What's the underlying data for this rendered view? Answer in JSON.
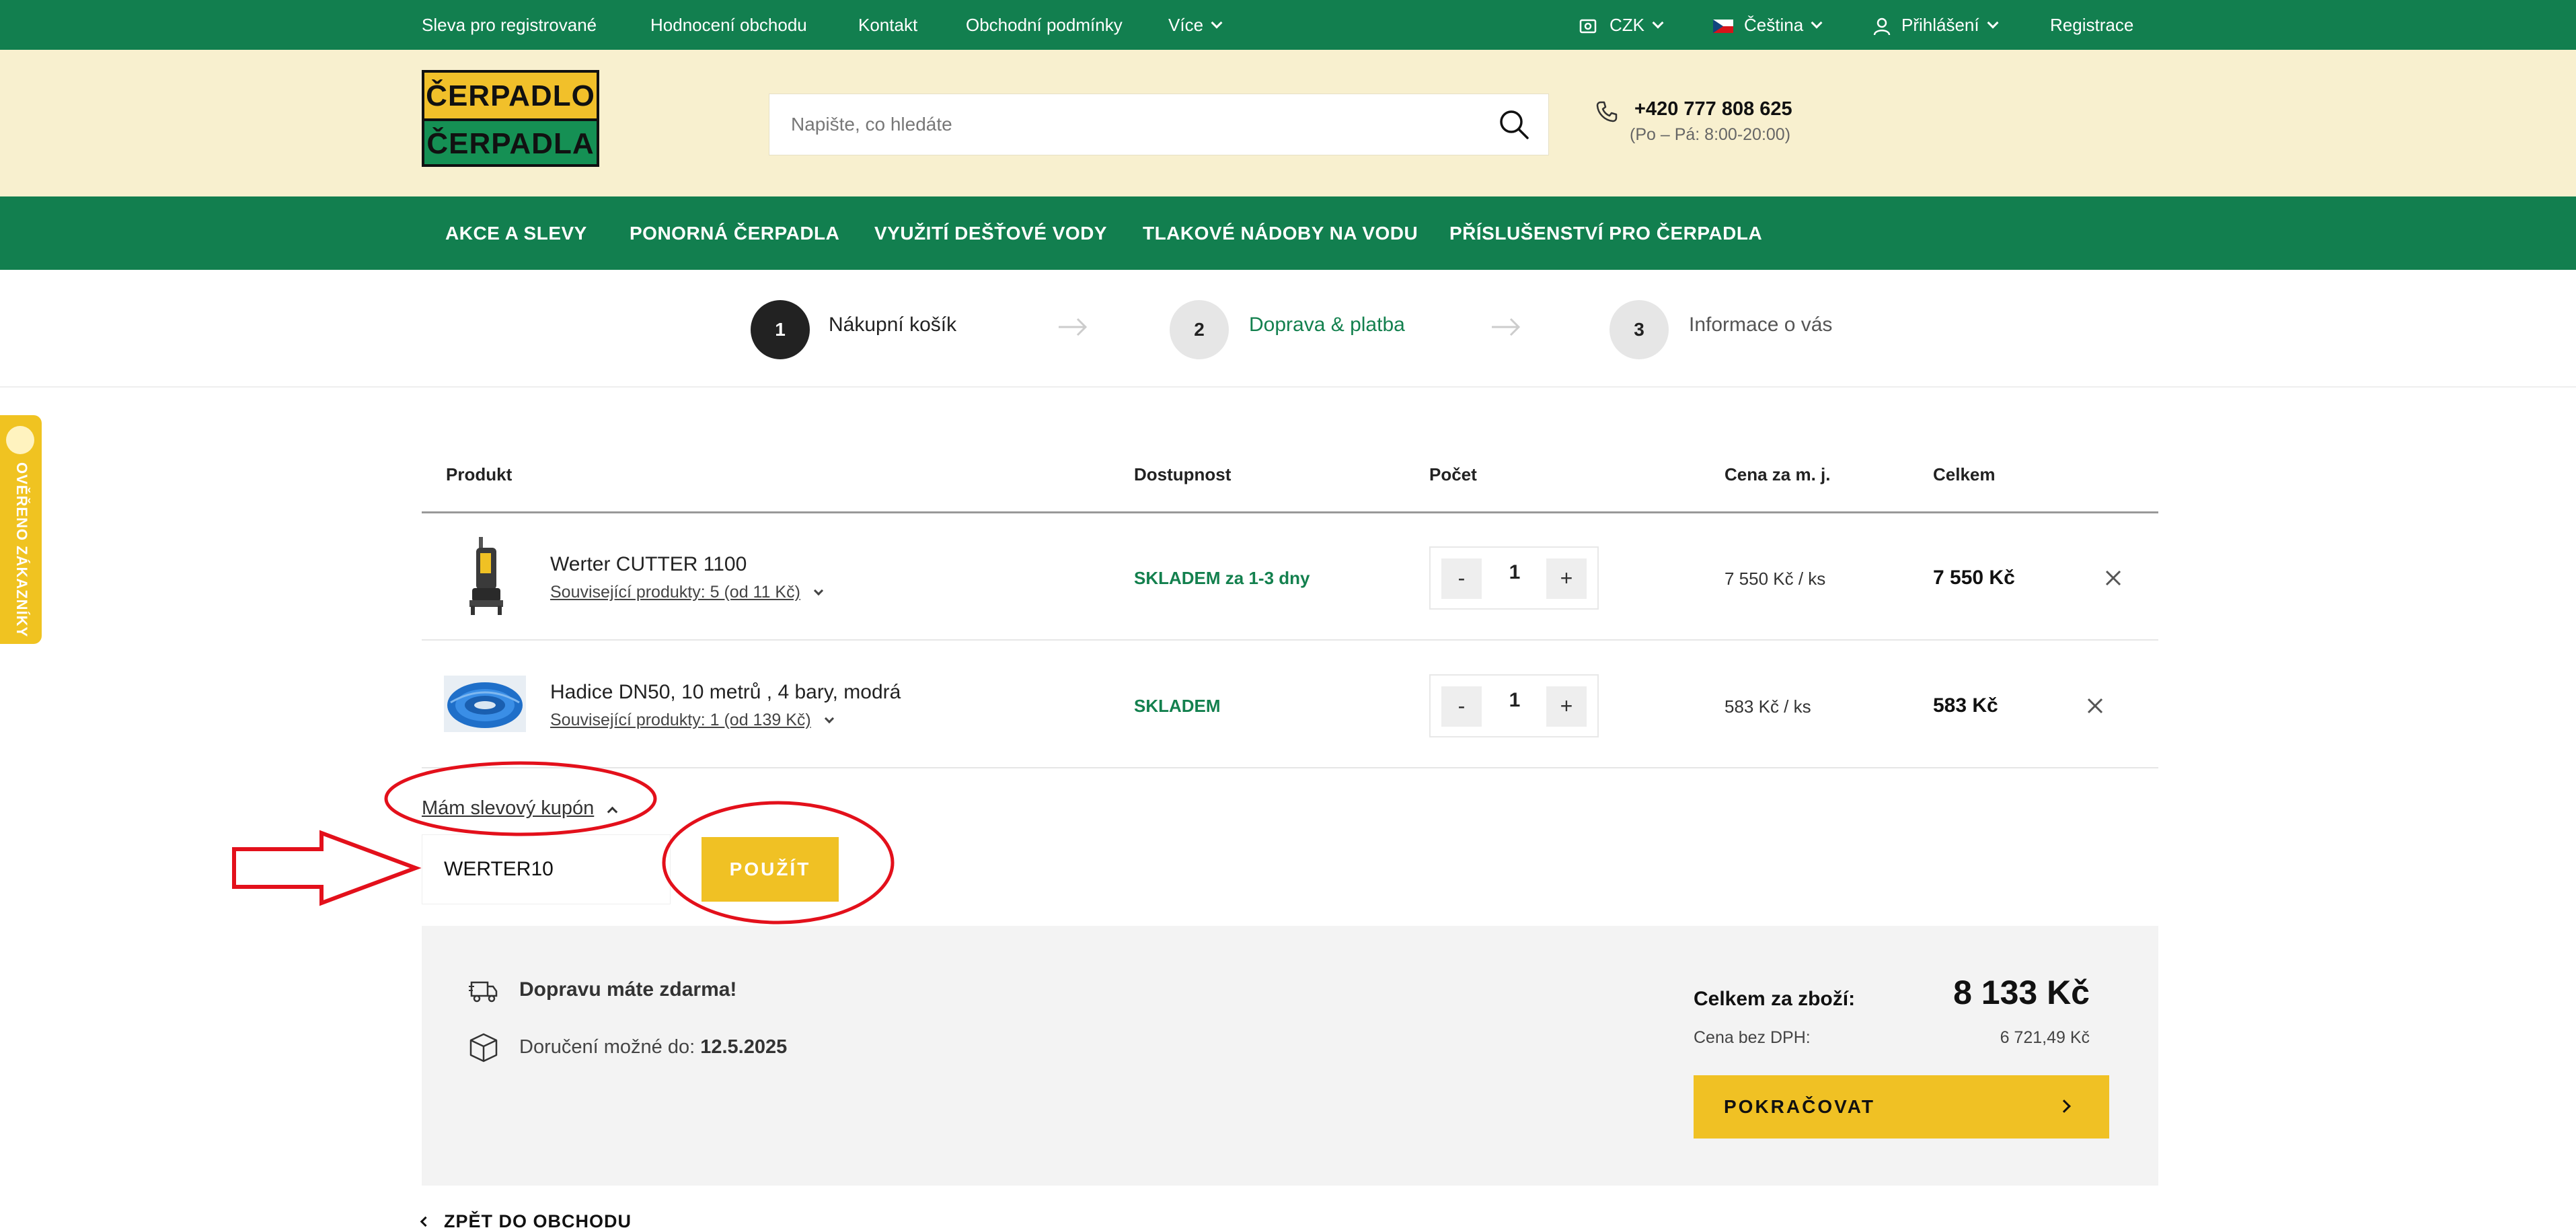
{
  "topbar": {
    "links": [
      "Sleva pro registrované",
      "Hodnocení obchodu",
      "Kontakt",
      "Obchodní podmínky",
      "Více"
    ],
    "currency": "CZK",
    "language": "Čeština",
    "login": "Přihlášení",
    "register": "Registrace"
  },
  "header": {
    "logo_top": "ČERPADLO",
    "logo_bottom": "ČERPADLA",
    "search_placeholder": "Napište, co hledáte",
    "phone": "+420 777 808 625",
    "hours": "(Po – Pá: 8:00-20:00)"
  },
  "nav": {
    "items": [
      "AKCE A SLEVY",
      "PONORNÁ ČERPADLA",
      "VYUŽITÍ DEŠŤOVÉ VODY",
      "TLAKOVÉ NÁDOBY NA VODU",
      "PŘÍSLUŠENSTVÍ PRO ČERPADLA"
    ]
  },
  "steps": [
    {
      "number": "1",
      "label": "Nákupní košík"
    },
    {
      "number": "2",
      "label": "Doprava & platba"
    },
    {
      "number": "3",
      "label": "Informace o vás"
    }
  ],
  "side_badge": "OVĚŘENO ZÁKAZNÍKY",
  "table": {
    "headers": {
      "product": "Produkt",
      "availability": "Dostupnost",
      "count": "Počet",
      "unit_price": "Cena za m. j.",
      "total": "Celkem"
    },
    "rows": [
      {
        "name": "Werter CUTTER 1100",
        "related": "Související produkty: 5 (od 11 Kč)",
        "stock": "SKLADEM za 1-3 dny",
        "qty": "1",
        "unit_price": "7 550 Kč / ks",
        "total": "7 550 Kč"
      },
      {
        "name": "Hadice DN50, 10 metrů , 4 bary, modrá",
        "related": "Související produkty: 1 (od 139 Kč)",
        "stock": "SKLADEM",
        "qty": "1",
        "unit_price": "583 Kč / ks",
        "total": "583 Kč"
      }
    ],
    "minus": "-",
    "plus": "+"
  },
  "coupon": {
    "toggle": "Mám slevový kupón",
    "value": "WERTER10",
    "apply": "POUŽÍT"
  },
  "summary": {
    "free_shipping": "Dopravu máte zdarma!",
    "delivery_label": "Doručení možné do:",
    "delivery_date": "12.5.2025",
    "total_label": "Celkem za zboží:",
    "total_value": "8 133 Kč",
    "net_label": "Cena bez DPH:",
    "net_value": "6 721,49 Kč",
    "continue": "POKRAČOVAT"
  },
  "back": "ZPĚT DO OBCHODU",
  "colors": {
    "green": "#127f4f",
    "cream": "#f8f0cf",
    "yellow": "#f0c124",
    "annotation_red": "#e3101b"
  }
}
